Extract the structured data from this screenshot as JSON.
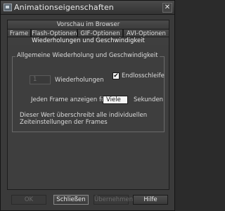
{
  "window": {
    "title": "Animationseigenschaften",
    "close_glyph": "✕"
  },
  "tabs": {
    "row1": [
      {
        "label": "Vorschau im Browser"
      }
    ],
    "row2": [
      {
        "label": "Frame"
      },
      {
        "label": "Flash-Optionen"
      },
      {
        "label": "GIF-Optionen"
      },
      {
        "label": "AVI-Optionen"
      }
    ],
    "active": {
      "label": "Wiederholungen und Geschwindigkeit"
    }
  },
  "group": {
    "legend": "Allgemeine Wiederholung und Geschwindigkeit",
    "repeat_count_value": "1",
    "repeat_label": "Wiederholungen",
    "endless_checkbox_label": "Endlosschleife",
    "endless_checked_glyph": "✔",
    "frame_label": "Jeden Frame anzeigen für:",
    "frame_combo_value": "Viele",
    "frame_unit": "Sekunden",
    "info_text": "Dieser Wert überschreibt alle individuellen Zeiteinstellungen der Frames"
  },
  "buttons": {
    "ok": "OK",
    "close": "Schließen",
    "apply": "Übernehmen",
    "help": "Hilfe"
  },
  "colors": {
    "window_bg": "#3a3a3a",
    "panel_bg": "#3e3e3e",
    "text": "#dcdcdc"
  }
}
